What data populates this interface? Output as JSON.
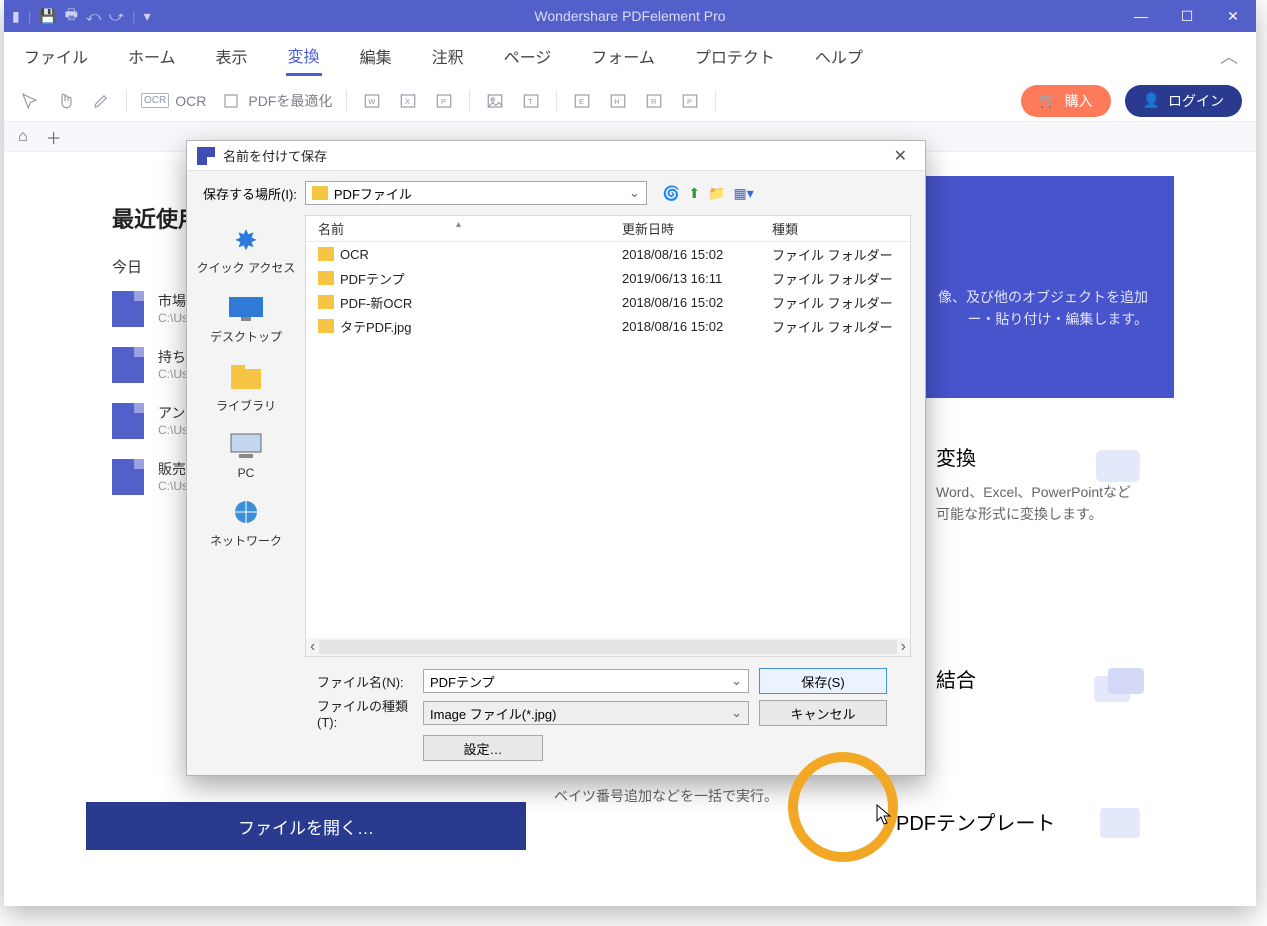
{
  "titlebar": {
    "app_title": "Wondershare PDFelement Pro"
  },
  "menubar": {
    "items": [
      "ファイル",
      "ホーム",
      "表示",
      "変換",
      "編集",
      "注釈",
      "ページ",
      "フォーム",
      "プロテクト",
      "ヘルプ"
    ],
    "active_index": 3
  },
  "toolbar": {
    "ocr_label": "OCR",
    "optimize_label": "PDFを最適化",
    "buy_label": "購入",
    "login_label": "ログイン"
  },
  "recent": {
    "title": "最近使用し",
    "today": "今日",
    "files": [
      {
        "name": "市場調",
        "path": "C:\\Use"
      },
      {
        "name": "持ち物",
        "path": "C:\\Use"
      },
      {
        "name": "アンケ",
        "path": "C:\\Use"
      },
      {
        "name": "販売付",
        "path": "C:\\Use"
      }
    ],
    "open_button": "ファイルを開く…"
  },
  "cards": {
    "edit_title": "",
    "edit_desc1": "像、及び他のオブジェクトを追加",
    "edit_desc2": "ー・貼り付け・編集します。",
    "convert_title": "変換",
    "convert_desc1": "Word、Excel、PowerPointなど",
    "convert_desc2": "可能な形式に変換します。",
    "combine_title": "結合",
    "bates": "ベイツ番号追加などを一括で実行。",
    "template_title": "PDFテンプレート"
  },
  "dialog": {
    "title": "名前を付けて保存",
    "save_in_label": "保存する場所(I):",
    "location": "PDFファイル",
    "columns": {
      "name": "名前",
      "date": "更新日時",
      "type": "種類"
    },
    "rows": [
      {
        "name": "OCR",
        "date": "2018/08/16 15:02",
        "type": "ファイル フォルダー"
      },
      {
        "name": "PDFテンプ",
        "date": "2019/06/13 16:11",
        "type": "ファイル フォルダー"
      },
      {
        "name": "PDF-新OCR",
        "date": "2018/08/16 15:02",
        "type": "ファイル フォルダー"
      },
      {
        "name": "タテPDF.jpg",
        "date": "2018/08/16 15:02",
        "type": "ファイル フォルダー"
      }
    ],
    "places": [
      "クイック アクセス",
      "デスクトップ",
      "ライブラリ",
      "PC",
      "ネットワーク"
    ],
    "filename_label": "ファイル名(N):",
    "filename_value": "PDFテンプ",
    "filetype_label": "ファイルの種類(T):",
    "filetype_value": "Image ファイル(*.jpg)",
    "save_button": "保存(S)",
    "cancel_button": "キャンセル",
    "settings_button": "設定…"
  }
}
